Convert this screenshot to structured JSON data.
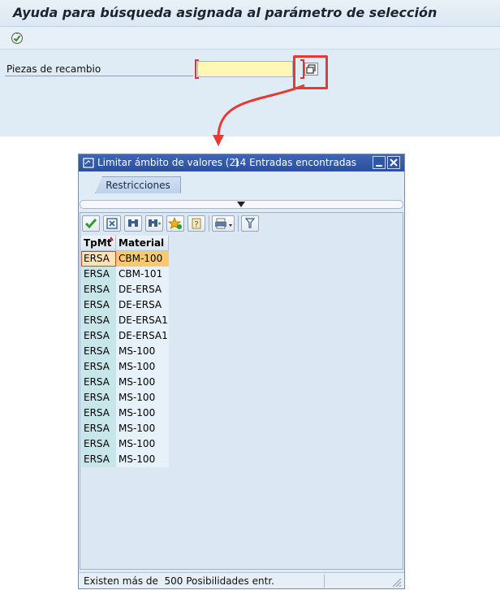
{
  "main": {
    "title": "Ayuda para búsqueda asignada al parámetro de selección",
    "field_label": "Piezas de recambio",
    "field_value": ""
  },
  "popup": {
    "title": "Limitar ámbito de valores (2)",
    "entries_found": "14 Entradas encontradas",
    "tab": "Restricciones",
    "columns": [
      "TpMt",
      "Material"
    ],
    "rows": [
      {
        "tp": "ERSA",
        "material": "CBM-100"
      },
      {
        "tp": "ERSA",
        "material": "CBM-101"
      },
      {
        "tp": "ERSA",
        "material": "DE-ERSA"
      },
      {
        "tp": "ERSA",
        "material": "DE-ERSA"
      },
      {
        "tp": "ERSA",
        "material": "DE-ERSA1"
      },
      {
        "tp": "ERSA",
        "material": "DE-ERSA1"
      },
      {
        "tp": "ERSA",
        "material": "MS-100"
      },
      {
        "tp": "ERSA",
        "material": "MS-100"
      },
      {
        "tp": "ERSA",
        "material": "MS-100"
      },
      {
        "tp": "ERSA",
        "material": "MS-100"
      },
      {
        "tp": "ERSA",
        "material": "MS-100"
      },
      {
        "tp": "ERSA",
        "material": "MS-100"
      },
      {
        "tp": "ERSA",
        "material": "MS-100"
      },
      {
        "tp": "ERSA",
        "material": "MS-100"
      }
    ],
    "selected_row": 0,
    "status": "Existen más de  500 Posibilidades entr."
  },
  "colors": {
    "title_bar": "#2c4f99",
    "highlight": "#e53935",
    "selected_cell": "#fbc86f",
    "required_field": "#fff7b3"
  },
  "icons": {
    "execute": "execute-icon",
    "value_help": "value-help-icon",
    "toolbar": [
      "check-icon",
      "cancel-icon",
      "find-icon",
      "find-next-icon",
      "favorites-icon",
      "help-icon",
      "print-icon",
      "filter-icon"
    ]
  }
}
